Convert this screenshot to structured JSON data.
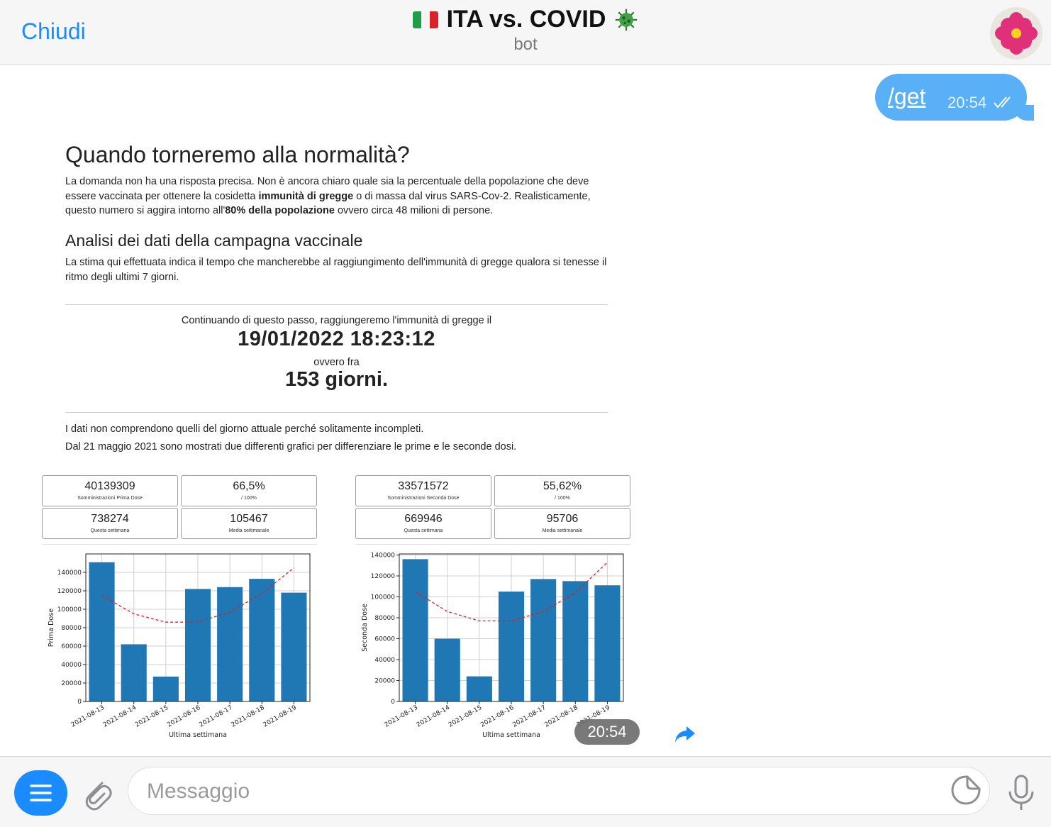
{
  "header": {
    "close_label": "Chiudi",
    "title": "ITA vs. COVID",
    "subtitle": "bot"
  },
  "outgoing": {
    "text": "/get",
    "time": "20:54"
  },
  "article": {
    "h1": "Quando torneremo alla normalità?",
    "intro_1": "La domanda non ha una risposta precisa. Non è ancora chiaro quale sia la percentuale della popolazione che deve essere vaccinata per ottenere la cosidetta ",
    "intro_bold_1": "immunità di gregge",
    "intro_2": " o di massa dal virus SARS-Cov-2. Realisticamente, questo numero si aggira intorno all'",
    "intro_bold_2": "80% della popolazione",
    "intro_3": " ovvero circa 48 milioni di persone.",
    "h2": "Analisi dei dati della campagna vaccinale",
    "analysis": "La stima qui effettuata indica il tempo che mancherebbe al raggiungimento dell'immunità di gregge qualora si tenesse il ritmo degli ultimi 7 giorni.",
    "continue_text": "Continuando di questo passo, raggiungeremo l'immunità di gregge il",
    "date": "19/01/2022 18:23:12",
    "ovvero": "ovvero fra",
    "days": "153 giorni.",
    "note_1": "I dati non comprendono quelli del giorno attuale perché solitamente incompleti.",
    "note_2": "Dal 21 maggio 2021 sono mostrati due differenti grafici per differenziare le prime e le seconde dosi."
  },
  "stats_first": [
    {
      "value": "40139309",
      "label": "Somministrazioni Prima Dose"
    },
    {
      "value": "66,5%",
      "label": "/ 100%"
    },
    {
      "value": "738274",
      "label": "Questa settimana"
    },
    {
      "value": "105467",
      "label": "Media settimanale"
    }
  ],
  "stats_second": [
    {
      "value": "33571572",
      "label": "Somministrazioni Seconda Dose"
    },
    {
      "value": "55,62%",
      "label": "/ 100%"
    },
    {
      "value": "669946",
      "label": "Questa settimana"
    },
    {
      "value": "95706",
      "label": "Media settimanale"
    }
  ],
  "chart_data": [
    {
      "type": "bar",
      "categories": [
        "2021-08-13",
        "2021-08-14",
        "2021-08-15",
        "2021-08-16",
        "2021-08-17",
        "2021-08-18",
        "2021-08-19"
      ],
      "values": [
        151000,
        62000,
        27000,
        122000,
        124000,
        133000,
        118000
      ],
      "trend": [
        115000,
        95000,
        86000,
        86000,
        97000,
        117000,
        145000
      ],
      "xlabel": "Ultima settimana",
      "ylabel": "Prima Dose",
      "ylim": [
        0,
        160000
      ],
      "yticks": [
        0,
        20000,
        40000,
        60000,
        80000,
        100000,
        120000,
        140000
      ],
      "grid": true,
      "bar_color": "#1f77b4",
      "trend_color": "#e02020"
    },
    {
      "type": "bar",
      "categories": [
        "2021-08-13",
        "2021-08-14",
        "2021-08-15",
        "2021-08-16",
        "2021-08-17",
        "2021-08-18",
        "2021-08-19"
      ],
      "values": [
        136000,
        60000,
        24000,
        105000,
        117000,
        115000,
        111000
      ],
      "trend": [
        105000,
        86000,
        77000,
        77000,
        86000,
        104000,
        133000
      ],
      "xlabel": "Ultima settimana",
      "ylabel": "Seconda Dose",
      "ylim": [
        0,
        141000
      ],
      "yticks": [
        0,
        20000,
        40000,
        60000,
        80000,
        100000,
        120000,
        140000
      ],
      "grid": true,
      "bar_color": "#1f77b4",
      "trend_color": "#e02020"
    }
  ],
  "photo_time": "20:54",
  "composer": {
    "placeholder": "Messaggio"
  },
  "colors": {
    "accent": "#1a8cff",
    "bubble": "#5ab0f7"
  },
  "icons": [
    "menu-icon",
    "attach-icon",
    "sticker-icon",
    "mic-icon",
    "share-icon",
    "double-check-icon",
    "italy-flag-icon",
    "virus-icon",
    "flower-avatar-icon"
  ]
}
